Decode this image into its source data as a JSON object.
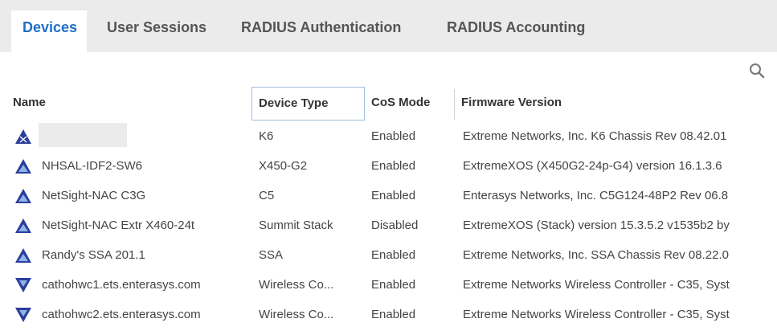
{
  "tabs": [
    {
      "label": "Devices",
      "active": true
    },
    {
      "label": "User Sessions",
      "active": false
    },
    {
      "label": "RADIUS Authentication",
      "active": false
    },
    {
      "label": "RADIUS Accounting",
      "active": false
    }
  ],
  "search": {
    "icon": "search-icon"
  },
  "columns": {
    "name": "Name",
    "device_type": "Device Type",
    "cos_mode": "CoS Mode",
    "firmware": "Firmware Version"
  },
  "rows": [
    {
      "icon": "switch-icon",
      "name": "",
      "device_type": "K6",
      "cos_mode": "Enabled",
      "firmware": "Extreme Networks, Inc. K6 Chassis Rev 08.42.01"
    },
    {
      "icon": "switch-icon",
      "name": "NHSAL-IDF2-SW6",
      "device_type": "X450-G2",
      "cos_mode": "Enabled",
      "firmware": "ExtremeXOS (X450G2-24p-G4) version 16.1.3.6"
    },
    {
      "icon": "switch-icon",
      "name": "NetSight-NAC C3G",
      "device_type": "C5",
      "cos_mode": "Enabled",
      "firmware": "Enterasys Networks, Inc. C5G124-48P2 Rev 06.8"
    },
    {
      "icon": "switch-icon",
      "name": "NetSight-NAC Extr X460-24t",
      "device_type": "Summit Stack",
      "cos_mode": "Disabled",
      "firmware": "ExtremeXOS (Stack) version 15.3.5.2 v1535b2 by"
    },
    {
      "icon": "switch-icon",
      "name": "Randy's SSA 201.1",
      "device_type": "SSA",
      "cos_mode": "Enabled",
      "firmware": "Extreme Networks, Inc. SSA Chassis Rev 08.22.0"
    },
    {
      "icon": "wireless-controller-icon",
      "name": "cathohwc1.ets.enterasys.com",
      "device_type": "Wireless Co...",
      "cos_mode": "Enabled",
      "firmware": "Extreme Networks Wireless Controller - C35, Syst"
    },
    {
      "icon": "wireless-controller-icon",
      "name": "cathohwc2.ets.enterasys.com",
      "device_type": "Wireless Co...",
      "cos_mode": "Enabled",
      "firmware": "Extreme Networks Wireless Controller - C35, Syst"
    }
  ]
}
